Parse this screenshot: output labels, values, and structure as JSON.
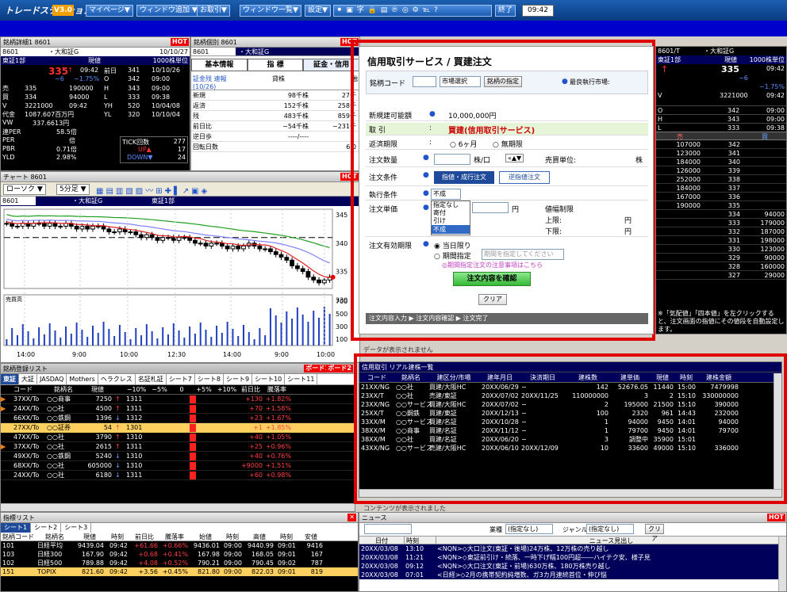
{
  "toolbar": {
    "logo": "トレードステーション",
    "version": "V3.0",
    "buttons": [
      "マイページ▼",
      "ウィンドウ追加 ▼",
      "お取引▼",
      "ウィンドウ一覧▼",
      "設定▼"
    ],
    "end_label": "終了",
    "clock": "09:42"
  },
  "quote": {
    "title": "銘柄詳細1 8601",
    "hot": "HOT",
    "code": "8601",
    "name": "・大和証G",
    "date": "10/10/27",
    "market": "東証1部",
    "price_label": "現値",
    "unit": "1000株単位",
    "price": "335",
    "price_time": "09:42",
    "prev_label": "前日",
    "prev": "341",
    "prev_date": "10/10/26",
    "chg": "−6",
    "chg_pct": "−1.75%",
    "o_label": "O",
    "o": "342",
    "o_time": "09:00",
    "rows": [
      [
        "売",
        "335",
        "190000",
        "H",
        "343",
        "09:00"
      ],
      [
        "買",
        "334",
        "94000",
        "L",
        "333",
        "09:38"
      ],
      [
        "V",
        "3221000",
        "09:42",
        "YH",
        "520",
        "10/04/08"
      ],
      [
        "代金",
        "1087.607百万円",
        "",
        "YL",
        "320",
        "10/10/04"
      ]
    ],
    "vwap": "337.6613円",
    "per_label": "連PER",
    "per": "58.5倍",
    "per2_label": "PER",
    "per2": "倍",
    "pbr_label": "PBR",
    "pbr": "0.71倍",
    "yld_label": "YLD",
    "yld": "2.98%",
    "tick_label": "TICK回数",
    "tick": "277",
    "up_label": "UP▲",
    "up": "17",
    "down_label": "DOWN▼",
    "down": "24"
  },
  "credit": {
    "title": "銘柄個別 8601",
    "hot": "HOT",
    "code": "8601",
    "name": "・大和証G",
    "tabs": [
      "基本情報",
      "指 標",
      "証金・信用"
    ],
    "head": [
      "証金残 速報(10/26)",
      "貸株",
      "融"
    ],
    "rows": [
      [
        "新規",
        "98千株",
        "27千"
      ],
      [
        "返済",
        "152千株",
        "258千"
      ],
      [
        "残",
        "483千株",
        "859千"
      ],
      [
        "前日比",
        "−54千株",
        "−231千"
      ],
      [
        "逆日歩",
        "----/----",
        ""
      ],
      [
        "回転日数",
        "",
        "6.0"
      ]
    ]
  },
  "chart": {
    "title": "チャート 8601",
    "hot": "HOT",
    "controls": [
      "ローソク ▼",
      "5分足 ▼"
    ],
    "code": "8601",
    "name": "・大和証G",
    "market": "東証1部",
    "yticks": [
      "345",
      "340",
      "335",
      "330"
    ],
    "vlabel": "売買高",
    "vticks": [
      "700",
      "500",
      "300",
      "100"
    ],
    "xticks": [
      "14:00",
      "9:00",
      "10:00",
      "12:30",
      "14:00",
      "9:00",
      "10:00"
    ],
    "closes": [
      343.5,
      343,
      343,
      343.5,
      343,
      343.5,
      343.5,
      343,
      343.5,
      343,
      343,
      343.5,
      343,
      342.5,
      343,
      342.5,
      343,
      343,
      342.5,
      342,
      342,
      342.5,
      342,
      342,
      341.5,
      341,
      341.5,
      341,
      340.5,
      341,
      341,
      340.5,
      341,
      341,
      340.5,
      340,
      340,
      339.5,
      340,
      340,
      339.5,
      339,
      339.5,
      339,
      339.5,
      340,
      339.5,
      339,
      339,
      338.5,
      338,
      337.5,
      337,
      336,
      335.5,
      335,
      334,
      333.5,
      333,
      333.5,
      334
    ]
  },
  "order": {
    "title": "信用取引サービス / 買建注文",
    "code_label": "銘柄コード",
    "market_select": "市場選択",
    "designate": "銘柄の指定",
    "best_market": "最良執行市場:",
    "avail_label": "新規建可能額",
    "avail": "10,000,000円",
    "trade_label": "取 引",
    "trade_value": "買建(信用取引サービス)",
    "period_label": "返済期限",
    "period_opt1": "6ヶ月",
    "period_opt2": "無期限",
    "qty_label": "注文数量",
    "qty_unit": "株/口",
    "trade_unit": "売買単位:",
    "share": "株",
    "cond_label": "注文条件",
    "cond_btn1": "指値・成行注文",
    "cond_btn2": "逆指値注文",
    "exec_label": "執行条件",
    "exec_value": "不成",
    "dropdown": [
      "指定なし",
      "寄付",
      "引け",
      "不成"
    ],
    "price_label": "注文単価",
    "yen": "円",
    "limit_label": "値幅制限",
    "upper": "上限:",
    "lower": "下限:",
    "valid_label": "注文有効期限",
    "valid1": "当日限り",
    "valid2": "期間指定",
    "valid2_sel": "期間を指定してください",
    "note": "◎期間指定注文の注意事項はこちら",
    "confirm": "注文内容を確認",
    "clear": "クリア",
    "steps": "注文内容入力 ▶ 注文内容確認 ▶ 注文完了"
  },
  "board": {
    "code": "8601/T",
    "name": "・大和証G",
    "market": "東証1部",
    "price_label": "現値",
    "unit": "1000株単位",
    "price": "335",
    "time": "09:42",
    "chg": "−6",
    "pct": "−1.75%",
    "v": "3221000",
    "v_time": "09:42",
    "ohl": [
      [
        "O",
        "342",
        "09:00"
      ],
      [
        "H",
        "343",
        "09:00"
      ],
      [
        "L",
        "333",
        "09:38"
      ]
    ],
    "sell_label": "売",
    "buy_label": "買",
    "asks": [
      [
        "107000",
        "342"
      ],
      [
        "123000",
        "341"
      ],
      [
        "184000",
        "340"
      ],
      [
        "126000",
        "339"
      ],
      [
        "252000",
        "338"
      ],
      [
        "184000",
        "337"
      ],
      [
        "167000",
        "336"
      ],
      [
        "190000",
        "335"
      ]
    ],
    "bids": [
      [
        "334",
        "94000"
      ],
      [
        "333",
        "179000"
      ],
      [
        "332",
        "187000"
      ],
      [
        "331",
        "198000"
      ],
      [
        "330",
        "123000"
      ],
      [
        "329",
        "90000"
      ],
      [
        "328",
        "160000"
      ],
      [
        "327",
        "29000"
      ]
    ],
    "note": "※「気配値」「四本値」を左クリックすると、注文画面の指値にその値段を自動設定します。"
  },
  "watch": {
    "title": "銘柄登録リスト",
    "board_btns": [
      "ボード1",
      "ボード2"
    ],
    "tabs": [
      "東証",
      "大証",
      "JASDAQ",
      "Mothers",
      "ヘラクレス",
      "名証札証",
      "シート7",
      "シート8",
      "シート9",
      "シート10",
      "シート11"
    ],
    "head": [
      "コード",
      "銘柄名",
      "現値",
      "",
      "−10%",
      "−5%",
      "0",
      "+5%",
      "+10%",
      "前日比",
      "騰落率"
    ],
    "rows": [
      [
        "37XX/To",
        "○○商事",
        "7250",
        "↑",
        "1311",
        "+130",
        "+1.82%"
      ],
      [
        "24XX/To",
        "○○社",
        "4500",
        "↑",
        "1311",
        "+70",
        "+1.58%"
      ],
      [
        "66XX/To",
        "○○鉄鋼",
        "1396",
        "↓",
        "1312",
        "+23",
        "+1.67%"
      ],
      [
        "27XX/To",
        "○○証券",
        "54",
        "↑",
        "1301",
        "+1",
        "+1.85%"
      ],
      [
        "47XX/To",
        "○○社",
        "3790",
        "↑",
        "1310",
        "+40",
        "+1.05%"
      ],
      [
        "37XX/To",
        "○○社",
        "2615",
        "↑",
        "1311",
        "+25",
        "+0.96%"
      ],
      [
        "49XX/To",
        "○○鉄鋼",
        "5240",
        "↓",
        "1310",
        "+40",
        "+0.76%"
      ],
      [
        "68XX/To",
        "○○社",
        "605000",
        "↓",
        "1310",
        "+9000",
        "+1.51%"
      ],
      [
        "24XX/To",
        "○○社",
        "6180",
        "↓",
        "1311",
        "+60",
        "+0.98%"
      ]
    ]
  },
  "positions": {
    "title": "信用取引 リアル建株一覧",
    "head": [
      "コード",
      "銘柄名",
      "建区分/市場",
      "建年月日",
      "決済期日",
      "建株数",
      "建単価",
      "現値",
      "時刻",
      "建株金額"
    ],
    "rows": [
      [
        "21XX/NG",
        "○○社",
        "買建/大阪HC",
        "20XX/06/29",
        "−",
        "142",
        "52676.05",
        "11440",
        "15:00",
        "7479998"
      ],
      [
        "23XX/T",
        "○○社",
        "売建/東証",
        "20XX/07/02",
        "20XX/11/25",
        "110000000",
        "3",
        "2",
        "15:10",
        "330000000"
      ],
      [
        "23XX/NG",
        "○○サービス",
        "買建/大阪HC",
        "20XX/07/02",
        "−",
        "2",
        "195000",
        "21500",
        "15:10",
        "390000"
      ],
      [
        "25XX/T",
        "○○鋼鉄",
        "買建/東証",
        "20XX/12/13",
        "−",
        "100",
        "2320",
        "961",
        "14:43",
        "232000"
      ],
      [
        "33XX/M",
        "○○サービス",
        "買建/名証",
        "20XX/10/28",
        "−",
        "1",
        "94000",
        "9450",
        "14:01",
        "94000"
      ],
      [
        "38XX/M",
        "○○商事",
        "買建/名証",
        "20XX/11/12",
        "−",
        "1",
        "79700",
        "9450",
        "14:01",
        "79700"
      ],
      [
        "38XX/M",
        "○○社",
        "買建/名証",
        "20XX/06/20",
        "−",
        "3",
        "調整中",
        "35900",
        "15:01",
        ""
      ],
      [
        "43XX/NG",
        "○○サービス",
        "売建/大阪HC",
        "20XX/06/10",
        "20XX/12/09",
        "10",
        "33600",
        "49000",
        "15:10",
        "336000"
      ]
    ]
  },
  "behind1": "データが表示されません",
  "behind2": "コンテンツが表示されました",
  "index": {
    "title": "指標リスト",
    "tabs": [
      "シート1",
      "シート2",
      "シート3"
    ],
    "head": [
      "銘柄コード",
      "銘柄名",
      "現値",
      "時刻",
      "前日比",
      "騰落率",
      "始値",
      "時刻",
      "高値",
      "時刻",
      "安値"
    ],
    "rows": [
      [
        "101",
        "日経平均",
        "9439.04",
        "09:42",
        "+61.66",
        "+0.66%",
        "9436.01",
        "09:00",
        "9440.99",
        "09:01",
        "9416"
      ],
      [
        "103",
        "日経300",
        "167.90",
        "09:42",
        "+0.68",
        "+0.41%",
        "167.98",
        "09:00",
        "168.05",
        "09:01",
        "167"
      ],
      [
        "102",
        "日経500",
        "789.88",
        "09:42",
        "+4.08",
        "+0.52%",
        "790.21",
        "09:00",
        "790.45",
        "09:02",
        "787"
      ],
      [
        "151",
        "TOPIX",
        "821.60",
        "09:42",
        "+3.56",
        "+0.45%",
        "821.80",
        "09:00",
        "822.03",
        "09:01",
        "819"
      ]
    ]
  },
  "news": {
    "title": "ニュース",
    "hot": "HOT",
    "industry_label": "業種",
    "industry_sel": "(指定なし)",
    "genre_label": "ジャンル",
    "genre_sel": "(指定なし)",
    "clear": "クリア",
    "head": [
      "日付",
      "時刻",
      "ニュース見出し"
    ],
    "rows": [
      [
        "20XX/03/08",
        "13:10",
        "<NQN>◇大口注文(東証・後場)24万株、12万株の売り越し"
      ],
      [
        "20XX/03/08",
        "11:21",
        "<NQN>◇東証前引け・続落、一時下げ幅100円超――ハイテク安、様子見"
      ],
      [
        "20XX/03/08",
        "09:12",
        "<NQN>◇大口注文(東証・前場)630万株、180万株売り越し"
      ],
      [
        "20XX/03/08",
        "07:01",
        "<日経>◇2月の携帯契約純増数、ガ3カ月連続首位・伸び悩"
      ]
    ]
  }
}
